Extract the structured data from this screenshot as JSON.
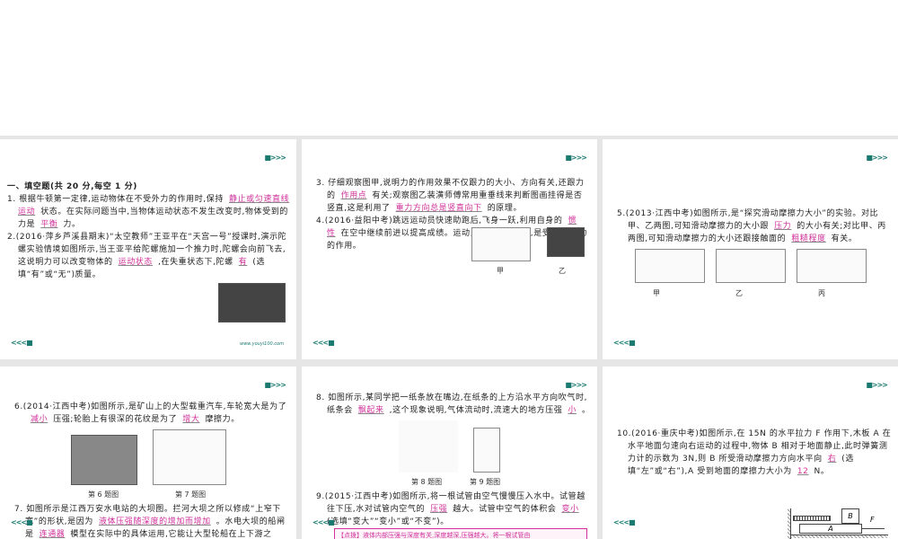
{
  "nav": {
    "next": "■>>>",
    "prev": "<<<■",
    "url": "www.youyi100.com"
  },
  "panels": [
    {
      "paras": [
        [
          {
            "t": "一、填空题(共 20 分,每空 1 分)"
          }
        ],
        [
          {
            "t": "1. 根据牛顿第一定律,运动物体在不受外力的作用时,保持"
          },
          {
            "a": "静止或匀速直线运动"
          },
          {
            "t": "状态。在实际问题当中,当物体运动状态不发生改变时,物体受到的力是"
          },
          {
            "a": "平衡"
          },
          {
            "t": "力。"
          }
        ],
        [
          {
            "t": "2.(2016·萍乡芦溪县期末)“太空教师”王亚平在“天宫一号”授课时,演示陀螺实验情境如图所示,当王亚平给陀螺施加一个推力时,陀螺会向前飞去,这说明力可以改变物体的"
          },
          {
            "a": "运动状态"
          },
          {
            "t": ",在失重状态下,陀螺"
          },
          {
            "a": "有"
          },
          {
            "t": "(选填“有”或“无”)质量。"
          }
        ]
      ]
    },
    {
      "paras": [
        [
          {
            "t": "3. 仔细观察图甲,说明力的作用效果不仅跟力的大小、方向有关,还跟力的"
          },
          {
            "a": "作用点"
          },
          {
            "t": "有关;观察图乙装潢师傅常用重垂线来判断图画挂得是否竖直,这是利用了"
          },
          {
            "a": "重力方向总是竖直向下"
          },
          {
            "t": "的原理。"
          }
        ],
        [
          {
            "t": "4.(2016·益阳中考)跳远运动员快速助跑后,飞身一跃,利用自身的"
          },
          {
            "a": "惯性"
          },
          {
            "t": "在空中继续前进以提高成绩。运动员最终落回地面,是受到"
          },
          {
            "a": "重"
          },
          {
            "t": "力的作用。"
          }
        ]
      ],
      "captions": [
        "甲",
        "乙"
      ]
    },
    {
      "paras": [
        [
          {
            "t": "5.(2013·江西中考)如图所示,是“探究滑动摩擦力大小”的实验。对比甲、乙两图,可知滑动摩擦力的大小跟"
          },
          {
            "a": "压力"
          },
          {
            "t": "的大小有关;对比甲、丙两图,可知滑动摩擦力的大小还跟接触面的"
          },
          {
            "a": "粗糙程度"
          },
          {
            "t": "有关。"
          }
        ]
      ],
      "captions": [
        "甲",
        "乙",
        "丙"
      ]
    },
    {
      "paras": [
        [
          {
            "t": "6.(2014·江西中考)如图所示,是矿山上的大型载重汽车,车轮宽大是为了"
          },
          {
            "a": "减小"
          },
          {
            "t": "压强;轮胎上有很深的花纹是为了"
          },
          {
            "a": "增大"
          },
          {
            "t": "摩擦力。"
          }
        ]
      ],
      "paras2": [
        [
          {
            "t": "7. 如图所示是江西万安水电站的大坝图。拦河大坝之所以修成“上窄下宽”的形状,是因为"
          },
          {
            "a": "液体压强随深度的增加而增加"
          },
          {
            "t": "。水电大坝的船闸是"
          },
          {
            "a": "连通器"
          },
          {
            "t": "模型在实际中的具体运用,它能让大型轮船在上下游之"
          }
        ]
      ],
      "captions": [
        "第 6 题图",
        "第 7 题图"
      ]
    },
    {
      "paras": [
        [
          {
            "t": "8. 如图所示,某同学把一纸条放在嘴边,在纸条的上方沿水平方向吹气时,纸条会"
          },
          {
            "a": "飘起来"
          },
          {
            "t": ",这个现象说明,气体流动时,流速大的地方压强"
          },
          {
            "a": "小"
          },
          {
            "t": "。"
          }
        ]
      ],
      "paras2": [
        [
          {
            "t": "9.(2015·江西中考)如图所示,将一根试管由空气慢慢压入水中。试管越往下压,水对试管内空气的"
          },
          {
            "a": "压强"
          },
          {
            "t": "越大。试管中空气的体积会"
          },
          {
            "a": "变小"
          },
          {
            "t": "(选填“变大”“变小”或“不变”)。"
          }
        ]
      ],
      "captions": [
        "第 8 题图",
        "第 9 题图"
      ],
      "tip": "【点拨】液体内部压强与深度有关,深度越深,压强越大。将一根试管由"
    },
    {
      "paras": [
        [
          {
            "t": "10.(2016·重庆中考)如图所示,在 15N 的水平拉力 F 作用下,木板 A 在水平地面匀速向右运动的过程中,物体 B 相对于地面静止,此时弹簧测力计的示数为 3N,则 B 所受滑动摩擦力方向水平向"
          },
          {
            "a": "右"
          },
          {
            "t": "(选填“左”或“右”),A 受到地面的摩擦力大小为"
          },
          {
            "a": "12"
          },
          {
            "t": "N。"
          }
        ]
      ],
      "labels": {
        "a": "A",
        "b": "B",
        "f": "F"
      }
    }
  ]
}
